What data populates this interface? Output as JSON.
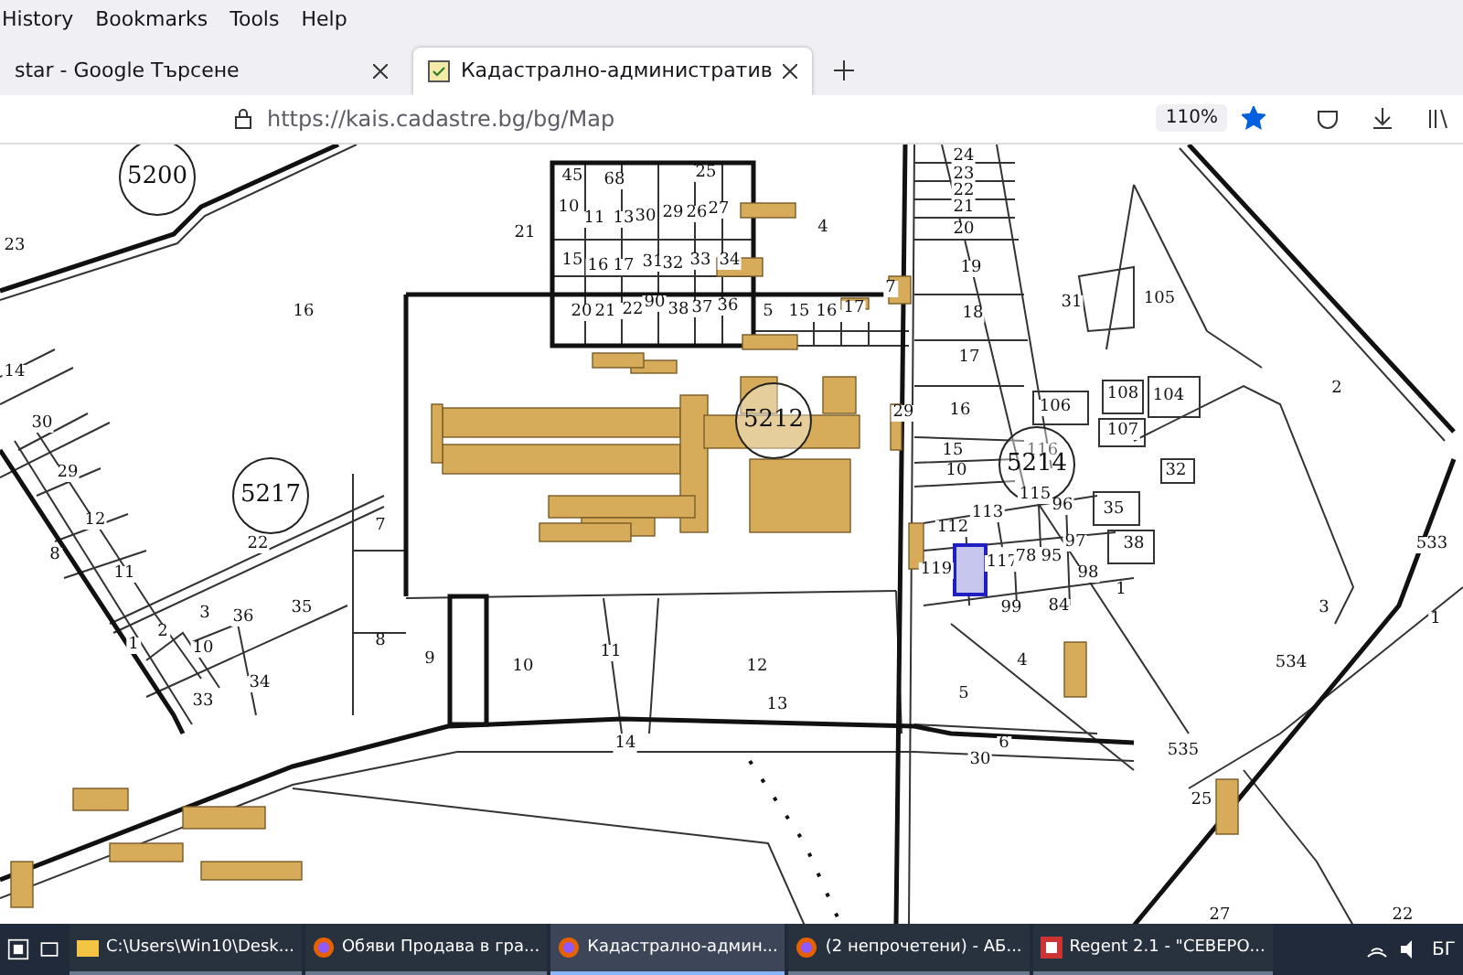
{
  "menu_bar": {
    "items": [
      "History",
      "Bookmarks",
      "Tools",
      "Help"
    ]
  },
  "tabs": [
    {
      "label": "star - Google Търсене",
      "selected": false
    },
    {
      "label": "Кадастрално-административ",
      "selected": true
    }
  ],
  "address_bar": {
    "url": "https://kais.cadastre.bg/bg/Map",
    "zoom": "110%",
    "bookmarked": true
  },
  "map": {
    "parcels": [
      {
        "label": "5200",
        "kind": "block"
      },
      {
        "label": "23",
        "kind": "parcel"
      },
      {
        "label": "16",
        "kind": "parcel"
      },
      {
        "label": "21",
        "kind": "parcel"
      },
      {
        "label": "14",
        "kind": "parcel"
      },
      {
        "label": "30",
        "kind": "parcel"
      },
      {
        "label": "29",
        "kind": "parcel"
      },
      {
        "label": "12",
        "kind": "parcel"
      },
      {
        "label": "5217",
        "kind": "block"
      },
      {
        "label": "7",
        "kind": "parcel"
      },
      {
        "label": "8",
        "kind": "parcel"
      },
      {
        "label": "11",
        "kind": "parcel"
      },
      {
        "label": "22",
        "kind": "parcel"
      },
      {
        "label": "35",
        "kind": "parcel"
      },
      {
        "label": "3",
        "kind": "parcel"
      },
      {
        "label": "36",
        "kind": "parcel"
      },
      {
        "label": "2",
        "kind": "parcel"
      },
      {
        "label": "1",
        "kind": "parcel"
      },
      {
        "label": "10",
        "kind": "parcel"
      },
      {
        "label": "33",
        "kind": "parcel"
      },
      {
        "label": "34",
        "kind": "parcel"
      },
      {
        "label": "8",
        "kind": "parcel"
      },
      {
        "label": "9",
        "kind": "parcel"
      },
      {
        "label": "10",
        "kind": "parcel"
      },
      {
        "label": "11",
        "kind": "parcel"
      },
      {
        "label": "12",
        "kind": "parcel"
      },
      {
        "label": "13",
        "kind": "parcel"
      },
      {
        "label": "14",
        "kind": "parcel"
      },
      {
        "label": "45",
        "kind": "parcel"
      },
      {
        "label": "68",
        "kind": "parcel"
      },
      {
        "label": "25",
        "kind": "parcel"
      },
      {
        "label": "10",
        "kind": "parcel"
      },
      {
        "label": "11",
        "kind": "parcel"
      },
      {
        "label": "13",
        "kind": "parcel"
      },
      {
        "label": "30",
        "kind": "parcel"
      },
      {
        "label": "29",
        "kind": "parcel"
      },
      {
        "label": "26",
        "kind": "parcel"
      },
      {
        "label": "27",
        "kind": "parcel"
      },
      {
        "label": "15",
        "kind": "parcel"
      },
      {
        "label": "16",
        "kind": "parcel"
      },
      {
        "label": "17",
        "kind": "parcel"
      },
      {
        "label": "31",
        "kind": "parcel"
      },
      {
        "label": "32",
        "kind": "parcel"
      },
      {
        "label": "33",
        "kind": "parcel"
      },
      {
        "label": "34",
        "kind": "parcel"
      },
      {
        "label": "20",
        "kind": "parcel"
      },
      {
        "label": "21",
        "kind": "parcel"
      },
      {
        "label": "22",
        "kind": "parcel"
      },
      {
        "label": "90",
        "kind": "parcel"
      },
      {
        "label": "38",
        "kind": "parcel"
      },
      {
        "label": "37",
        "kind": "parcel"
      },
      {
        "label": "36",
        "kind": "parcel"
      },
      {
        "label": "4",
        "kind": "parcel"
      },
      {
        "label": "5",
        "kind": "parcel"
      },
      {
        "label": "15",
        "kind": "parcel"
      },
      {
        "label": "16",
        "kind": "parcel"
      },
      {
        "label": "17",
        "kind": "parcel"
      },
      {
        "label": "7",
        "kind": "parcel"
      },
      {
        "label": "5212",
        "kind": "block"
      },
      {
        "label": "29",
        "kind": "parcel"
      },
      {
        "label": "24",
        "kind": "parcel"
      },
      {
        "label": "23",
        "kind": "parcel"
      },
      {
        "label": "22",
        "kind": "parcel"
      },
      {
        "label": "21",
        "kind": "parcel"
      },
      {
        "label": "20",
        "kind": "parcel"
      },
      {
        "label": "19",
        "kind": "parcel"
      },
      {
        "label": "18",
        "kind": "parcel"
      },
      {
        "label": "17",
        "kind": "parcel"
      },
      {
        "label": "16",
        "kind": "parcel"
      },
      {
        "label": "15",
        "kind": "parcel"
      },
      {
        "label": "10",
        "kind": "parcel"
      },
      {
        "label": "31",
        "kind": "parcel"
      },
      {
        "label": "105",
        "kind": "parcel"
      },
      {
        "label": "106",
        "kind": "parcel"
      },
      {
        "label": "108",
        "kind": "parcel"
      },
      {
        "label": "104",
        "kind": "parcel"
      },
      {
        "label": "107",
        "kind": "parcel"
      },
      {
        "label": "116",
        "kind": "parcel"
      },
      {
        "label": "5214",
        "kind": "block"
      },
      {
        "label": "115",
        "kind": "parcel"
      },
      {
        "label": "113",
        "kind": "parcel"
      },
      {
        "label": "112",
        "kind": "parcel"
      },
      {
        "label": "96",
        "kind": "parcel"
      },
      {
        "label": "35",
        "kind": "parcel"
      },
      {
        "label": "32",
        "kind": "parcel"
      },
      {
        "label": "2",
        "kind": "parcel"
      },
      {
        "label": "97",
        "kind": "parcel"
      },
      {
        "label": "38",
        "kind": "parcel"
      },
      {
        "label": "119",
        "kind": "parcel"
      },
      {
        "label": "117",
        "kind": "parcel"
      },
      {
        "label": "78",
        "kind": "parcel"
      },
      {
        "label": "95",
        "kind": "parcel"
      },
      {
        "label": "98",
        "kind": "parcel"
      },
      {
        "label": "1",
        "kind": "parcel"
      },
      {
        "label": "99",
        "kind": "parcel"
      },
      {
        "label": "84",
        "kind": "parcel"
      },
      {
        "label": "4",
        "kind": "parcel"
      },
      {
        "label": "533",
        "kind": "parcel"
      },
      {
        "label": "1",
        "kind": "parcel"
      },
      {
        "label": "534",
        "kind": "parcel"
      },
      {
        "label": "3",
        "kind": "parcel"
      },
      {
        "label": "5",
        "kind": "parcel"
      },
      {
        "label": "6",
        "kind": "parcel"
      },
      {
        "label": "30",
        "kind": "parcel"
      },
      {
        "label": "535",
        "kind": "parcel"
      },
      {
        "label": "25",
        "kind": "parcel"
      },
      {
        "label": "27",
        "kind": "parcel"
      },
      {
        "label": "22",
        "kind": "parcel"
      }
    ]
  },
  "taskbar": {
    "items": [
      {
        "label": "C:\\Users\\Win10\\Desk...",
        "kind": "folder",
        "selected": false
      },
      {
        "label": "Обяви Продава в гра...",
        "kind": "browser",
        "selected": false
      },
      {
        "label": "Кадастрално-админ...",
        "kind": "browser",
        "selected": true
      },
      {
        "label": "(2 непрочетени) - АБ...",
        "kind": "browser",
        "selected": false
      },
      {
        "label": "Regent 2.1 - \"СЕВЕРО...",
        "kind": "app",
        "selected": false
      }
    ],
    "language": "БГ"
  }
}
